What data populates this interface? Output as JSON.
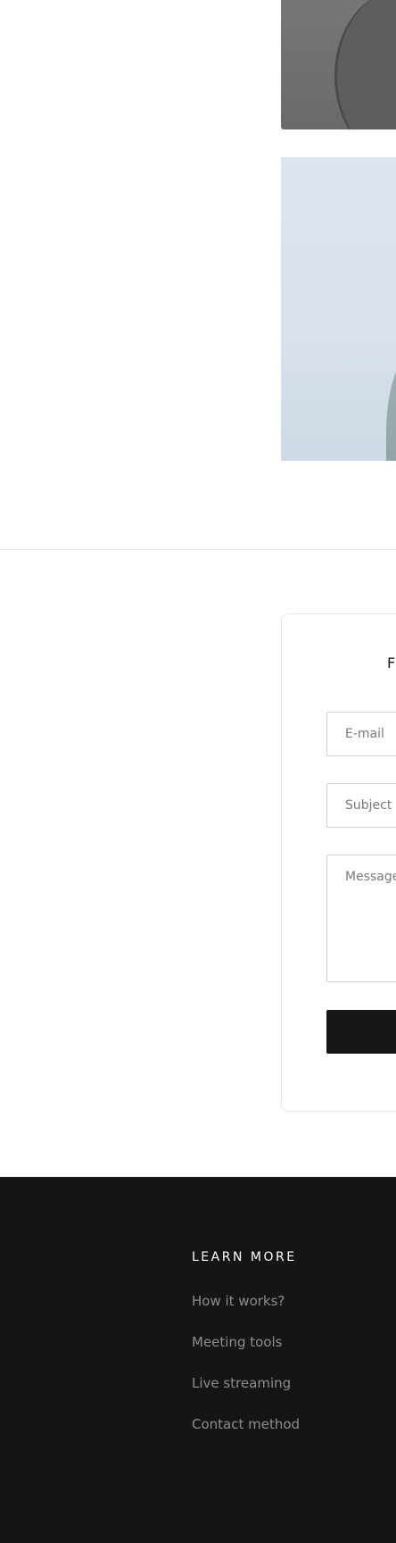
{
  "contact_form": {
    "title": "F",
    "email_placeholder": "E-mail",
    "subject_placeholder": "Subject",
    "message_placeholder": "Message",
    "send_label": ""
  },
  "footer": {
    "heading": "LEARN MORE",
    "links": [
      "How it works?",
      "Meeting tools",
      "Live streaming",
      "Contact method"
    ]
  }
}
